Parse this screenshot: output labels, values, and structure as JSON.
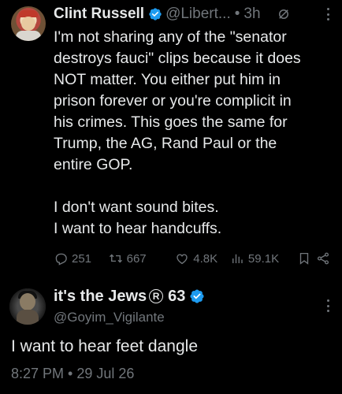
{
  "tweet": {
    "author_name": "Clint Russell",
    "handle": "@Libert...",
    "separator": "•",
    "time": "3h",
    "lines": [
      "I'm not sharing any of the \"senator",
      "destroys fauci\" clips because it does",
      "NOT matter. You either put him in",
      "prison forever or you're complicit in",
      "his crimes. This goes the same for",
      "Trump, the AG, Rand Paul or the",
      "entire GOP."
    ],
    "lines2": [
      "I don't want sound bites.",
      "I want to hear handcuffs."
    ],
    "stats": {
      "replies": "251",
      "retweets": "667",
      "likes": "4.8K",
      "views": "59.1K"
    }
  },
  "reply": {
    "author_name": "it's the Jews",
    "badge_letter": "R",
    "badge_number": "63",
    "handle": "@Goyim_Vigilante",
    "text": "I want to hear feet dangle",
    "timestamp": "8:27 PM • 29 Jul 26"
  },
  "colors": {
    "background": "#000000",
    "text": "#e7e9ea",
    "muted": "#71767b",
    "verified": "#1d9bf0"
  },
  "icons": [
    "verified-badge-icon",
    "grok-icon",
    "more-icon",
    "reply-icon",
    "retweet-icon",
    "like-icon",
    "views-icon",
    "bookmark-icon",
    "share-icon"
  ]
}
